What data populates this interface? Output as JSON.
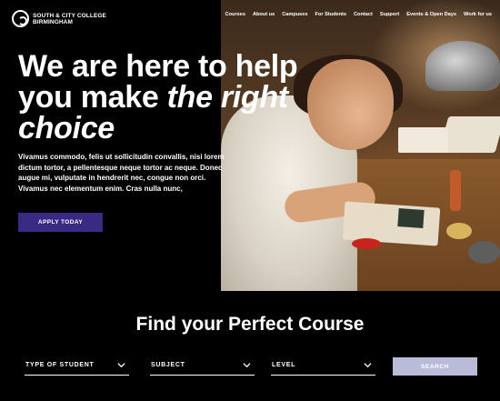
{
  "logo": {
    "line1": "SOUTH & CITY COLLEGE",
    "line2": "BIRMINGHAM"
  },
  "nav": {
    "items": [
      "Courses",
      "About us",
      "Campuses",
      "For Students",
      "Contact",
      "Support",
      "Events & Open Days",
      "Work for us"
    ]
  },
  "hero": {
    "headline_part1": "We are here to help you make ",
    "headline_emphasis": "the right choice",
    "intro": "Vivamus commodo, felis ut sollicitudin convallis, nisi lorem dictum tortor, a pellentesque neque tortor ac neque. Donec augue mi, vulputate in hendrerit nec, congue non orci. Vivamus nec elementum enim. Cras nulla nunc,",
    "apply_label": "APPLY TODAY"
  },
  "finder": {
    "title": "Find your Perfect Course",
    "filters": [
      "TYPE OF STUDENT",
      "SUBJECT",
      "LEVEL"
    ],
    "search_label": "SEARCH"
  },
  "colors": {
    "background": "#000000",
    "accent": "#3a2a84",
    "search_button": "#b9bbd8",
    "text": "#ffffff"
  }
}
